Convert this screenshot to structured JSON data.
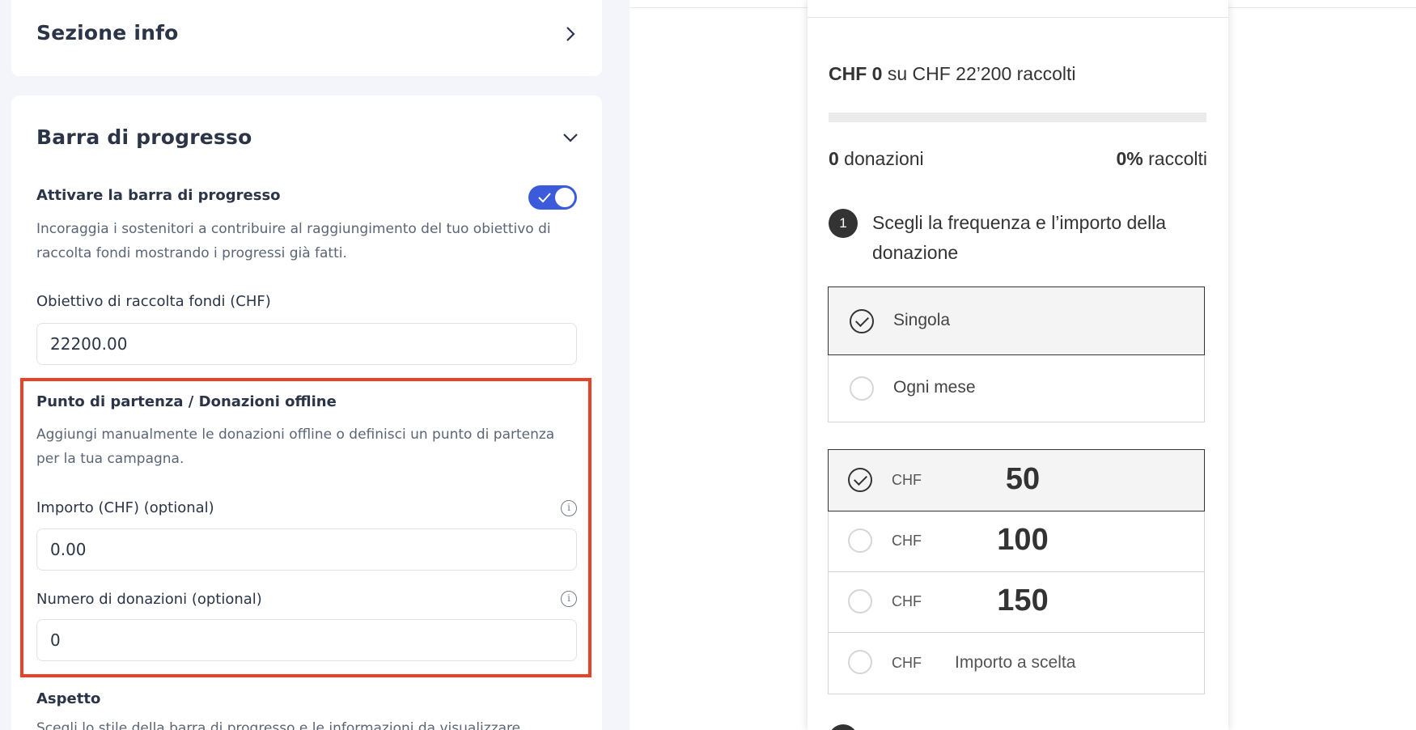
{
  "settings": {
    "info_section": {
      "title": "Sezione info"
    },
    "progress_section": {
      "title": "Barra di progresso",
      "toggle": {
        "label": "Attivare la barra di progresso",
        "enabled": true,
        "help": "Incoraggia i sostenitori a contribuire al raggiungimento del tuo obiettivo di raccolta fondi mostrando i progressi già fatti."
      },
      "goal": {
        "label": "Obiettivo di raccolta fondi (CHF)",
        "value": "22200.00"
      },
      "offline": {
        "title": "Punto di partenza / Donazioni offline",
        "help": "Aggiungi manualmente le donazioni offline o definisci un punto di partenza per la tua campagna.",
        "amount_label": "Importo (CHF) (optional)",
        "amount_value": "0.00",
        "count_label": "Numero di donazioni (optional)",
        "count_value": "0"
      },
      "appearance": {
        "title": "Aspetto",
        "help": "Scegli lo stile della barra di progresso e le informazioni da visualizzare."
      }
    }
  },
  "preview": {
    "raised": {
      "amount": "CHF 0",
      "suffix": " su CHF 22’200 raccolti"
    },
    "progress_fraction": 0,
    "donations": {
      "count": "0",
      "label": " donazioni"
    },
    "percent": {
      "value": "0%",
      "label": " raccolti"
    },
    "step": {
      "number": "1",
      "title": "Scegli la frequenza e l’importo della donazione"
    },
    "frequency": [
      {
        "label": "Singola",
        "selected": true
      },
      {
        "label": "Ogni mese",
        "selected": false
      }
    ],
    "currency": "CHF",
    "amounts": [
      {
        "value": "50",
        "selected": true
      },
      {
        "value": "100",
        "selected": false
      },
      {
        "value": "150",
        "selected": false
      }
    ],
    "custom_amount_label": "Importo a scelta"
  },
  "colors": {
    "accent": "#3b5bdb",
    "highlight": "#e8432a"
  }
}
